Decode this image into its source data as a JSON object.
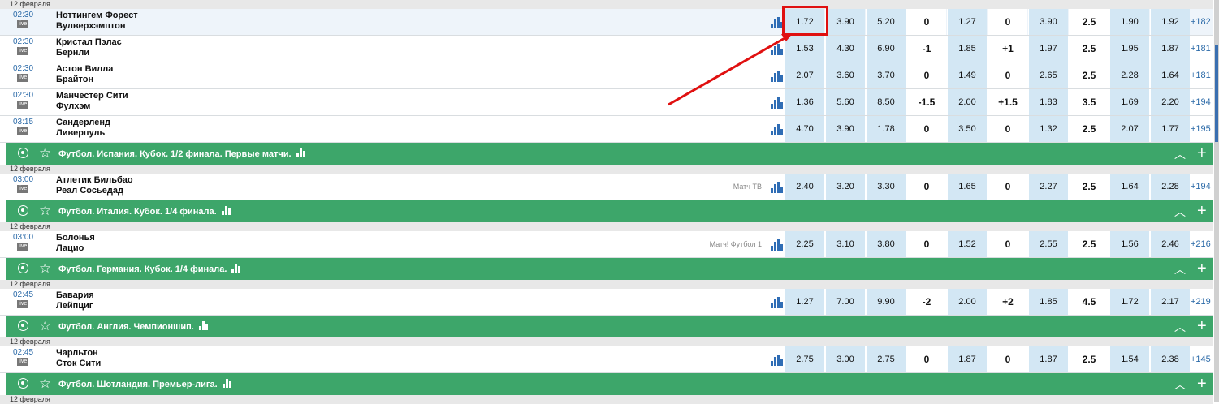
{
  "top_date": "12 февраля",
  "live_label": "live",
  "groups": [
    {
      "matches": [
        {
          "time": "02:30",
          "home": "Ноттингем Форест",
          "away": "Вулверхэмптон",
          "tv": "",
          "odds": [
            "1.72",
            "3.90",
            "5.20",
            "0",
            "1.27",
            "0",
            "3.90",
            "2.5",
            "1.90",
            "1.92"
          ],
          "more": "+182"
        },
        {
          "time": "02:30",
          "home": "Кристал Пэлас",
          "away": "Бернли",
          "tv": "",
          "odds": [
            "1.53",
            "4.30",
            "6.90",
            "-1",
            "1.85",
            "+1",
            "1.97",
            "2.5",
            "1.95",
            "1.87"
          ],
          "more": "+181"
        },
        {
          "time": "02:30",
          "home": "Астон Вилла",
          "away": "Брайтон",
          "tv": "",
          "odds": [
            "2.07",
            "3.60",
            "3.70",
            "0",
            "1.49",
            "0",
            "2.65",
            "2.5",
            "2.28",
            "1.64"
          ],
          "more": "+181"
        },
        {
          "time": "02:30",
          "home": "Манчестер Сити",
          "away": "Фулхэм",
          "tv": "",
          "odds": [
            "1.36",
            "5.60",
            "8.50",
            "-1.5",
            "2.00",
            "+1.5",
            "1.83",
            "3.5",
            "1.69",
            "2.20"
          ],
          "more": "+194"
        },
        {
          "time": "03:15",
          "home": "Сандерленд",
          "away": "Ливерпуль",
          "tv": "",
          "odds": [
            "4.70",
            "3.90",
            "1.78",
            "0",
            "3.50",
            "0",
            "1.32",
            "2.5",
            "2.07",
            "1.77"
          ],
          "more": "+195"
        }
      ]
    },
    {
      "league": "Футбол. Испания. Кубок. 1/2 финала. Первые матчи.",
      "date": "12 февраля",
      "matches": [
        {
          "time": "03:00",
          "home": "Атлетик Бильбао",
          "away": "Реал Сосьедад",
          "tv": "Матч ТВ",
          "odds": [
            "2.40",
            "3.20",
            "3.30",
            "0",
            "1.65",
            "0",
            "2.27",
            "2.5",
            "1.64",
            "2.28"
          ],
          "more": "+194"
        }
      ]
    },
    {
      "league": "Футбол. Италия. Кубок. 1/4 финала.",
      "date": "12 февраля",
      "matches": [
        {
          "time": "03:00",
          "home": "Болонья",
          "away": "Лацио",
          "tv": "Матч! Футбол 1",
          "odds": [
            "2.25",
            "3.10",
            "3.80",
            "0",
            "1.52",
            "0",
            "2.55",
            "2.5",
            "1.56",
            "2.46"
          ],
          "more": "+216"
        }
      ]
    },
    {
      "league": "Футбол. Германия. Кубок. 1/4 финала.",
      "date": "12 февраля",
      "matches": [
        {
          "time": "02:45",
          "home": "Бавария",
          "away": "Лейпциг",
          "tv": "",
          "odds": [
            "1.27",
            "7.00",
            "9.90",
            "-2",
            "2.00",
            "+2",
            "1.85",
            "4.5",
            "1.72",
            "2.17"
          ],
          "more": "+219"
        }
      ]
    },
    {
      "league": "Футбол. Англия. Чемпионшип.",
      "date": "12 февраля",
      "matches": [
        {
          "time": "02:45",
          "home": "Чарльтон",
          "away": "Сток Сити",
          "tv": "",
          "odds": [
            "2.75",
            "3.00",
            "2.75",
            "0",
            "1.87",
            "0",
            "1.87",
            "2.5",
            "1.54",
            "2.38"
          ],
          "more": "+145"
        }
      ]
    },
    {
      "league": "Футбол. Шотландия. Премьер-лига.",
      "date": "12 февраля",
      "matches": []
    }
  ],
  "icons": {
    "league": "soccer-ball-icon",
    "favorite": "star-icon",
    "stats": "bar-chart-icon",
    "collapse": "chevron-up-icon",
    "add": "plus-icon"
  },
  "colors": {
    "league_bar": "#3da66a",
    "odds_cell": "#d3e7f4",
    "time": "#2b6aa8",
    "annotation": "#e01010"
  },
  "highlighted_odd": "1.72"
}
